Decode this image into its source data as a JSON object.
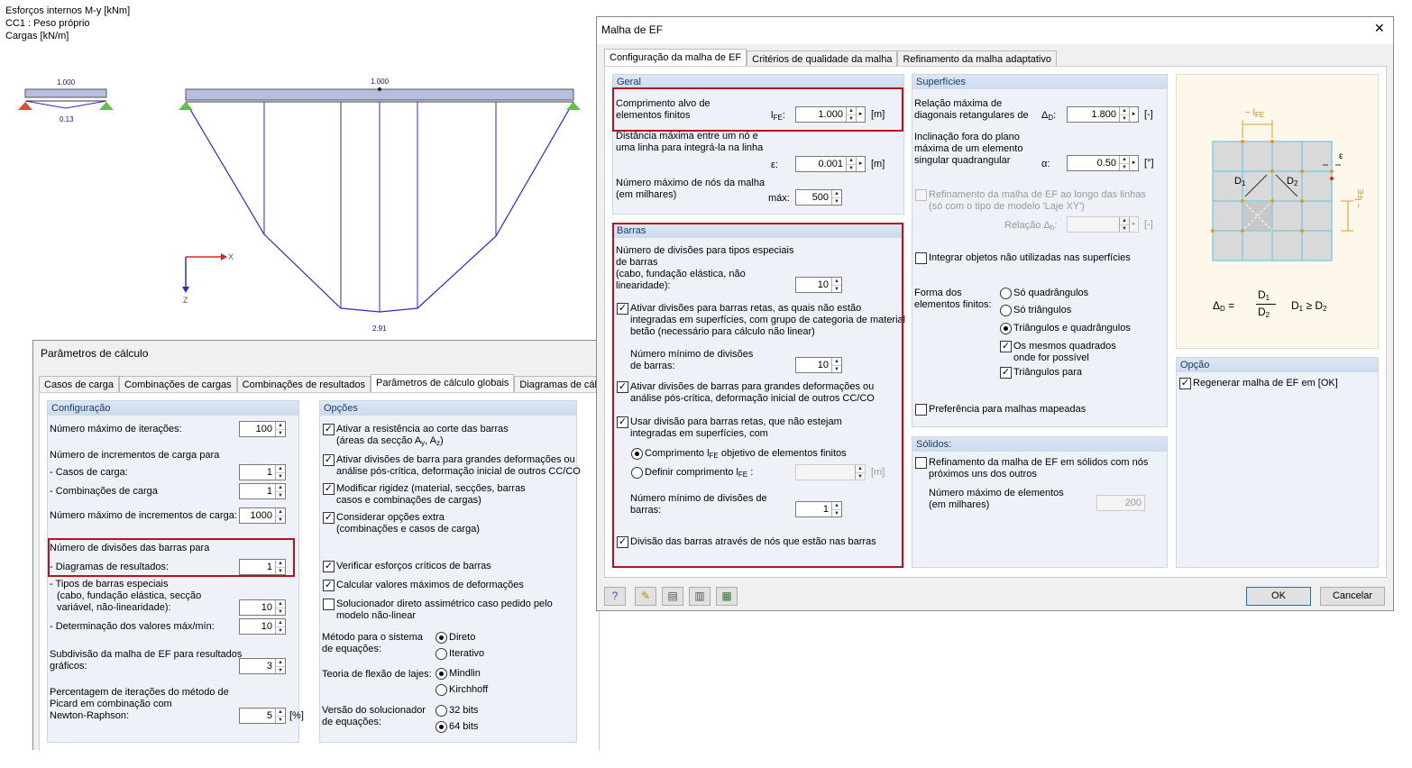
{
  "bg": {
    "line1": "Esforços internos M-y [kNm]",
    "line2": "CC1 : Peso próprio",
    "line3": "Cargas [kN/m]",
    "small_load": "1.000",
    "small_moment": "0.13",
    "big_load": "1.000",
    "big_moment": "2.91",
    "axis_x": "X",
    "axis_z": "Z"
  },
  "calc": {
    "title": "Parâmetros de cálculo",
    "tabs": [
      "Casos de carga",
      "Combinações de cargas",
      "Combinações de resultados",
      "Parâmetros de cálculo globais",
      "Diagramas de cálculo"
    ],
    "config": {
      "header": "Configuração",
      "max_iter_label": "Número máximo de iterações:",
      "max_iter": "100",
      "incr_label": "Número de incrementos de carga para",
      "lc_label": "- Casos de carga:",
      "lc": "1",
      "combo_label": "- Combinações de carga",
      "combo": "1",
      "max_incr_label": "Número máximo de incrementos de carga:",
      "max_incr": "1000",
      "div_label": "Número de divisões das barras para",
      "diag_label": "- Diagramas de resultados:",
      "diag": "1",
      "special_l1": "- Tipos de barras especiais",
      "special_l2": "(cabo, fundação elástica, secção",
      "special_l3": "variável, não-linearidade):",
      "special": "10",
      "det_label": "- Determinação dos valores máx/mín:",
      "det": "10",
      "sub_l1": "Subdivisão da malha de EF para resultados",
      "sub_l2": "gráficos:",
      "sub": "3",
      "pct_l1": "Percentagem de iterações do método de",
      "pct_l2": "Picard em combinação com",
      "pct_l3": "Newton-Raphson:",
      "pct": "5",
      "pct_unit": "[%]"
    },
    "opts": {
      "header": "Opções",
      "o1a": "Ativar a resistência ao corte das barras",
      "o1b": "(áreas da secção A",
      "o1y": "y",
      "o1c": ", A",
      "o1z": "z",
      "o1d": ")",
      "o2a": "Ativar divisões de barra para grandes deformações ou",
      "o2b": "análise pós-crítica, deformação inicial de outros CC/CO",
      "o3a": "Modificar rigidez (material, secções, barras",
      "o3b": "casos e combinações de cargas)",
      "o4a": "Considerar opções extra",
      "o4b": "(combinações e casos de carga)",
      "o5": "Verificar esforços críticos de barras",
      "o6": "Calcular valores máximos de deformações",
      "o7a": "Solucionador direto assimétrico caso pedido pelo",
      "o7b": "modelo não-linear",
      "m_l1": "Método para o sistema",
      "m_l2": "de equações:",
      "m_r1": "Direto",
      "m_r2": "Iterativo",
      "f_l1": "Teoria de flexão de lajes:",
      "f_r1": "Mindlin",
      "f_r2": "Kirchhoff",
      "s_l1": "Versão do solucionador",
      "s_l2": "de equações:",
      "s_r1": "32 bits",
      "s_r2": "64 bits"
    }
  },
  "mesh": {
    "title": "Malha de EF",
    "close": "✕",
    "tabs": [
      "Configuração da malha de EF",
      "Critérios de qualidade da malha",
      "Refinamento da malha adaptativo"
    ],
    "geral": {
      "header": "Geral",
      "t_l1": "Comprimento alvo de",
      "t_l2": "elementos finitos",
      "t_sym": "l",
      "t_sub": "FE",
      "t_val": "1.000",
      "t_unit": "[m]",
      "d_l1": "Distância máxima entre um nó e",
      "d_l2": "uma linha para integrá-la na linha",
      "d_sym": "ε:",
      "d_val": "0.001",
      "d_unit": "[m]",
      "n_l1": "Número máximo de nós da malha",
      "n_l2": "(em milhares)",
      "n_sym": "máx:",
      "n_val": "500"
    },
    "barras": {
      "header": "Barras",
      "a_l1": "Número de divisões para tipos especiais",
      "a_l2": "de barras",
      "a_l3": "(cabo, fundação elástica, não",
      "a_l4": "linearidade):",
      "a_val": "10",
      "b_l1": "Ativar divisões para barras retas, as quais não estão",
      "b_l2": "integradas em superfícies, com grupo de categoria de material",
      "b_l3": "betão (necessário para cálculo não linear)",
      "c_l1": "Número mínimo de divisões",
      "c_l2": "de barras:",
      "c_val": "10",
      "d_l1": "Ativar divisões de barras para grandes deformações ou",
      "d_l2": "análise pós-crítica, deformação inicial de outros CC/CO",
      "e_l1": "Usar divisão para barras retas, que não estejam",
      "e_l2": "integradas em superfícies, com",
      "r1a": "Comprimento l",
      "r1s": "FE",
      "r1b": " objetivo de elementos finitos",
      "r2a": "Definir comprimento l",
      "r2s": "FE",
      "r2b": " :",
      "r2_unit": "[m]",
      "f_l1": "Número mínimo de divisões de",
      "f_l2": "barras:",
      "f_val": "1",
      "g": "Divisão das barras através de nós que estão nas barras"
    },
    "surf": {
      "header": "Superfícies",
      "a_l1": "Relação máxima de",
      "a_l2": "diagonais retangulares de",
      "a_sym": "Δ",
      "a_sub": "D",
      "a_val": "1.800",
      "a_unit": "[-]",
      "b_l1": "Inclinação fora do plano",
      "b_l2": "máxima de um elemento",
      "b_l3": "singular quadrangular",
      "b_sym": "α:",
      "b_val": "0.50",
      "b_unit": "[°]",
      "c_l1": "Refinamento da malha de EF ao longo das linhas",
      "c_l2": "(só com o tipo de modelo 'Laje XY')",
      "c_rel": "Relação",
      "c_sym": "Δ",
      "c_sub": "b",
      "c_unit": "[-]",
      "d": "Integrar objetos não utilizadas nas superfícies",
      "f_l1": "Forma dos",
      "f_l2": "elementos finitos:",
      "f_r1": "Só quadrângulos",
      "f_r2": "Só triângulos",
      "f_r3": "Triângulos e quadrângulos",
      "f_c1a": "Os mesmos quadrados",
      "f_c1b": "onde for possível",
      "f_c2": "Triângulos para",
      "g": "Preferência para malhas mapeadas"
    },
    "solid": {
      "header": "Sólidos:",
      "a_l1": "Refinamento da malha de EF em sólidos com nós",
      "a_l2": "próximos uns dos outros",
      "b_l1": "Número máximo de elementos",
      "b_l2": "(em milhares)",
      "b_val": "200"
    },
    "opcao": {
      "header": "Opção",
      "a": "Regenerar malha de EF em [OK]"
    },
    "fig": {
      "lfe": "~ l",
      "lfe_sub": "FE",
      "eps": "ε",
      "d1": "D",
      "d1s": "1",
      "d2": "D",
      "d2s": "2",
      "ratio_l": "Δ",
      "ratio_ls": "D",
      "eq": "=",
      "cond": "D",
      "cond_s1": "1",
      "cond_ge": " ≥ D",
      "cond_s2": "2"
    },
    "ok": "OK",
    "cancel": "Cancelar"
  }
}
